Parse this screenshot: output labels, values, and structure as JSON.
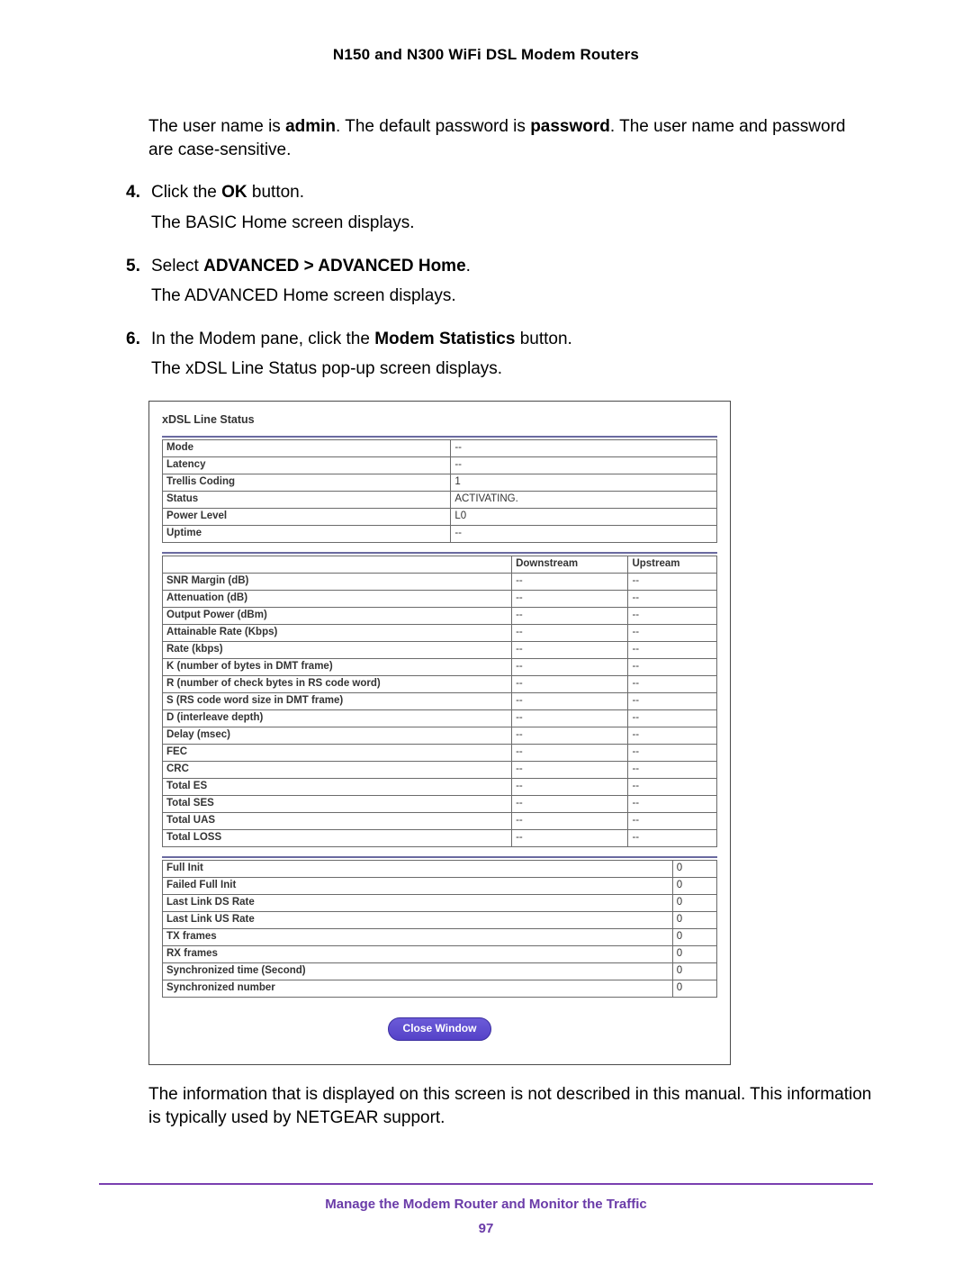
{
  "header": "N150 and N300 WiFi DSL Modem Routers",
  "intro_pre": "The user name is ",
  "intro_admin": "admin",
  "intro_mid": ". The default password is ",
  "intro_pw": "password",
  "intro_post": ". The user name and password are case-sensitive.",
  "step4": {
    "num": "4.",
    "l1a": "Click the ",
    "l1b": "OK",
    "l1c": " button.",
    "l2": "The BASIC Home screen displays."
  },
  "step5": {
    "num": "5.",
    "l1a": "Select ",
    "l1b": "ADVANCED > ADVANCED Home",
    "l1c": ".",
    "l2": "The ADVANCED Home screen displays."
  },
  "step6": {
    "num": "6.",
    "l1a": "In the Modem pane, click the ",
    "l1b": "Modem Statistics",
    "l1c": " button.",
    "l2": "The xDSL Line Status pop-up screen displays."
  },
  "shot": {
    "title": "xDSL Line Status",
    "t1": [
      {
        "k": "Mode",
        "v": "--"
      },
      {
        "k": "Latency",
        "v": "--"
      },
      {
        "k": "Trellis Coding",
        "v": "1"
      },
      {
        "k": "Status",
        "v": "ACTIVATING."
      },
      {
        "k": "Power Level",
        "v": "L0"
      },
      {
        "k": "Uptime",
        "v": "--"
      }
    ],
    "t2head": {
      "c1": "",
      "c2": "Downstream",
      "c3": "Upstream"
    },
    "t2": [
      {
        "k": "SNR Margin (dB)",
        "d": "--",
        "u": "--"
      },
      {
        "k": "Attenuation (dB)",
        "d": "--",
        "u": "--"
      },
      {
        "k": "Output Power (dBm)",
        "d": "--",
        "u": "--"
      },
      {
        "k": "Attainable Rate (Kbps)",
        "d": "--",
        "u": "--"
      },
      {
        "k": "Rate (kbps)",
        "d": "--",
        "u": "--"
      },
      {
        "k": "K (number of bytes in DMT frame)",
        "d": "--",
        "u": "--"
      },
      {
        "k": "R (number of check bytes in RS code word)",
        "d": "--",
        "u": "--"
      },
      {
        "k": "S (RS code word size in DMT frame)",
        "d": "--",
        "u": "--"
      },
      {
        "k": "D (interleave depth)",
        "d": "--",
        "u": "--"
      },
      {
        "k": "Delay (msec)",
        "d": "--",
        "u": "--"
      },
      {
        "k": "FEC",
        "d": "--",
        "u": "--"
      },
      {
        "k": "CRC",
        "d": "--",
        "u": "--"
      },
      {
        "k": "Total ES",
        "d": "--",
        "u": "--"
      },
      {
        "k": "Total SES",
        "d": "--",
        "u": "--"
      },
      {
        "k": "Total UAS",
        "d": "--",
        "u": "--"
      },
      {
        "k": "Total LOSS",
        "d": "--",
        "u": "--"
      }
    ],
    "t3": [
      {
        "k": "Full Init",
        "v": "0"
      },
      {
        "k": "Failed Full Init",
        "v": "0"
      },
      {
        "k": "Last Link DS Rate",
        "v": "0"
      },
      {
        "k": "Last Link US Rate",
        "v": "0"
      },
      {
        "k": "TX frames",
        "v": "0"
      },
      {
        "k": "RX frames",
        "v": "0"
      },
      {
        "k": "Synchronized time (Second)",
        "v": "0"
      },
      {
        "k": "Synchronized number",
        "v": "0"
      }
    ],
    "close": "Close Window"
  },
  "outro": "The information that is displayed on this screen is not described in this manual. This information is typically used by NETGEAR support.",
  "footer_title": "Manage the Modem Router and Monitor the Traffic",
  "footer_page": "97"
}
